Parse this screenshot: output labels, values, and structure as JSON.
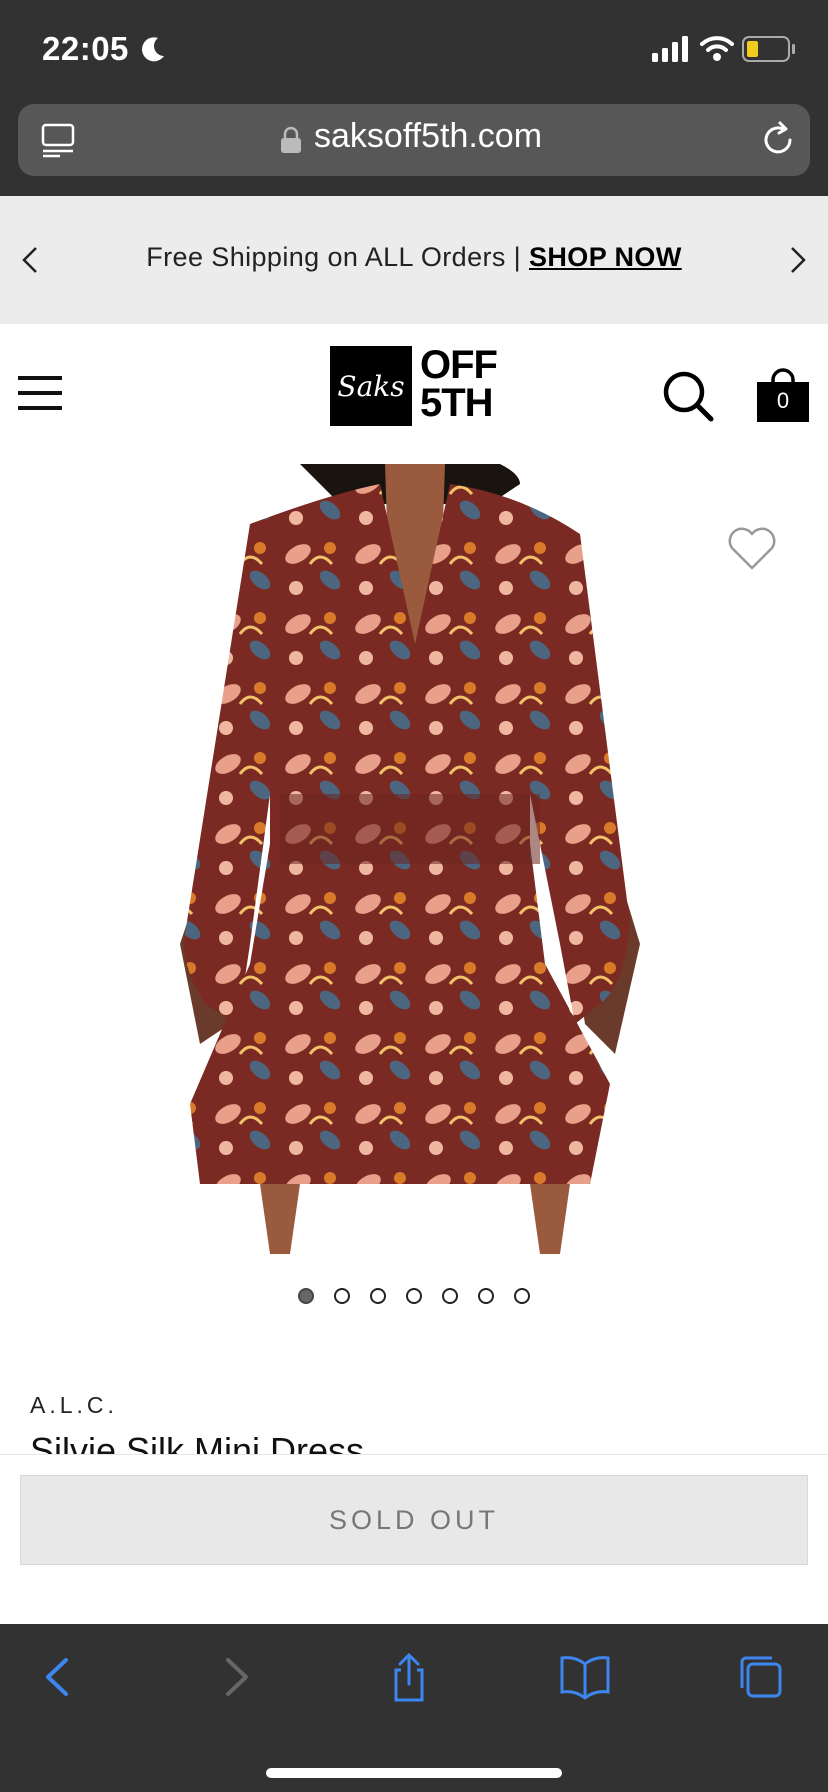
{
  "status": {
    "time": "22:05"
  },
  "browser": {
    "url": "saksoff5th.com"
  },
  "promo": {
    "text": "Free Shipping on ALL Orders | ",
    "link": "SHOP NOW"
  },
  "header": {
    "logo_mark": "Saks",
    "logo_line1": "OFF",
    "logo_line2": "5TH",
    "bag_count": "0"
  },
  "gallery": {
    "image_count": 7,
    "active_index": 0
  },
  "product": {
    "brand": "A.L.C.",
    "name": "Silvie Silk Mini Dress"
  },
  "cta": {
    "label": "SOLD OUT"
  },
  "colors": {
    "chrome": "#323233",
    "accent_blue": "#3d86f0",
    "promo_bg": "#ececec"
  }
}
